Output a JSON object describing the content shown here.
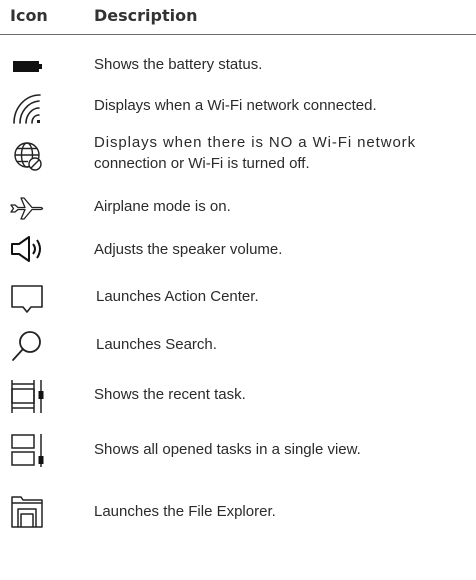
{
  "header": {
    "icon_label": "Icon",
    "description_label": "Description"
  },
  "rows": [
    {
      "icon": "battery-icon",
      "text": "Shows the battery status."
    },
    {
      "icon": "wifi-icon",
      "text": "Displays when a Wi-Fi network connected."
    },
    {
      "icon": "globe-no-network-icon",
      "text_line1": "Displays when there is NO a Wi-Fi network",
      "text_line2": "connection or Wi-Fi is turned off."
    },
    {
      "icon": "airplane-icon",
      "text": "Airplane mode is on."
    },
    {
      "icon": "speaker-icon",
      "text": "Adjusts the speaker volume."
    },
    {
      "icon": "action-center-icon",
      "text": "Launches Action Center."
    },
    {
      "icon": "search-icon",
      "text": "Launches Search."
    },
    {
      "icon": "recent-task-icon",
      "text": "Shows the recent task."
    },
    {
      "icon": "task-view-icon",
      "text": "Shows all opened tasks in a single view."
    },
    {
      "icon": "file-explorer-icon",
      "text": "Launches the File Explorer."
    }
  ]
}
